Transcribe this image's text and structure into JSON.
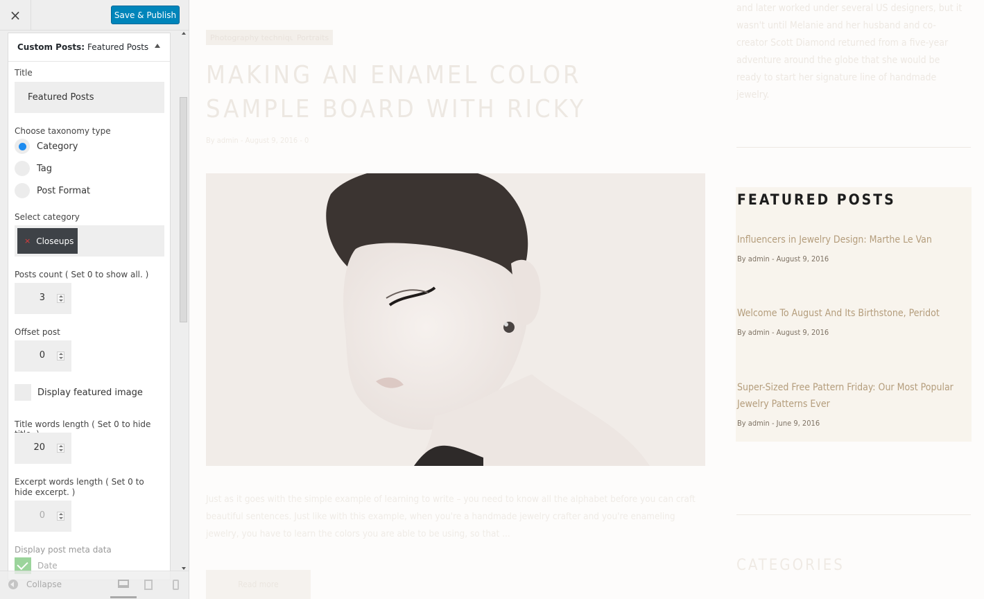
{
  "topbar": {
    "close_glyph": "×",
    "save_label": "Save & Publish"
  },
  "panel": {
    "heading_prefix": "Custom Posts:",
    "heading_name": "Featured Posts",
    "title_label": "Title",
    "title_value": "Featured Posts",
    "taxonomy_label": "Choose taxonomy type",
    "taxonomy_options": [
      "Category",
      "Tag",
      "Post Format"
    ],
    "taxonomy_selected": "Category",
    "category_label": "Select category",
    "category_chip_remove": "×",
    "category_chip": "Closeups",
    "posts_count_label": "Posts count ( Set 0 to show all. )",
    "posts_count_value": "3",
    "offset_label": "Offset post",
    "offset_value": "0",
    "featured_image_label": "Display featured image",
    "title_words_label": "Title words length ( Set 0 to hide title. )",
    "title_words_value": "20",
    "excerpt_words_label": "Excerpt words length ( Set 0 to hide excerpt. )",
    "excerpt_words_value": "0",
    "meta_label": "Display post meta data",
    "meta_date_label": "Date"
  },
  "footer": {
    "collapse_label": "Collapse"
  },
  "preview": {
    "tags": [
      "Photography techniques",
      "Portraits"
    ],
    "post_title": "Making an enamel color sample board with Ricky",
    "post_meta": "By admin - August 9, 2016 - 0",
    "excerpt": "Just as it goes with the simple example of learning to write – you need to know all the alphabet before you can craft beautiful sentences. Just like with this example, when you're a handmade jewelry crafter and you're enameling jewelry, you have to learn the colors you are able to be using, so that ...",
    "read_more": "Read more",
    "side_text": "and later worked under several US designers, but it wasn't until Melanie and her husband and co-creator Scott Diamond returned from a five-year adventure around the globe that she would be ready to start her signature line of handmade jewelry.",
    "featured_title": "Featured Posts",
    "featured_posts": [
      {
        "title": "Influencers in Jewelry Design: Marthe Le Van",
        "meta": "By admin - August 9, 2016"
      },
      {
        "title": "Welcome To August And Its Birthstone, Peridot",
        "meta": "By admin - August 9, 2016"
      },
      {
        "title": "Super-Sized Free Pattern Friday: Our Most Popular Jewelry Patterns Ever",
        "meta": "By admin - June 9, 2016"
      }
    ],
    "categories_title": "Categories"
  },
  "colors": {
    "accent": "#0085ba",
    "radio_on": "#1e8cf0",
    "chip": "#3e4247",
    "link": "#b49d7c"
  }
}
